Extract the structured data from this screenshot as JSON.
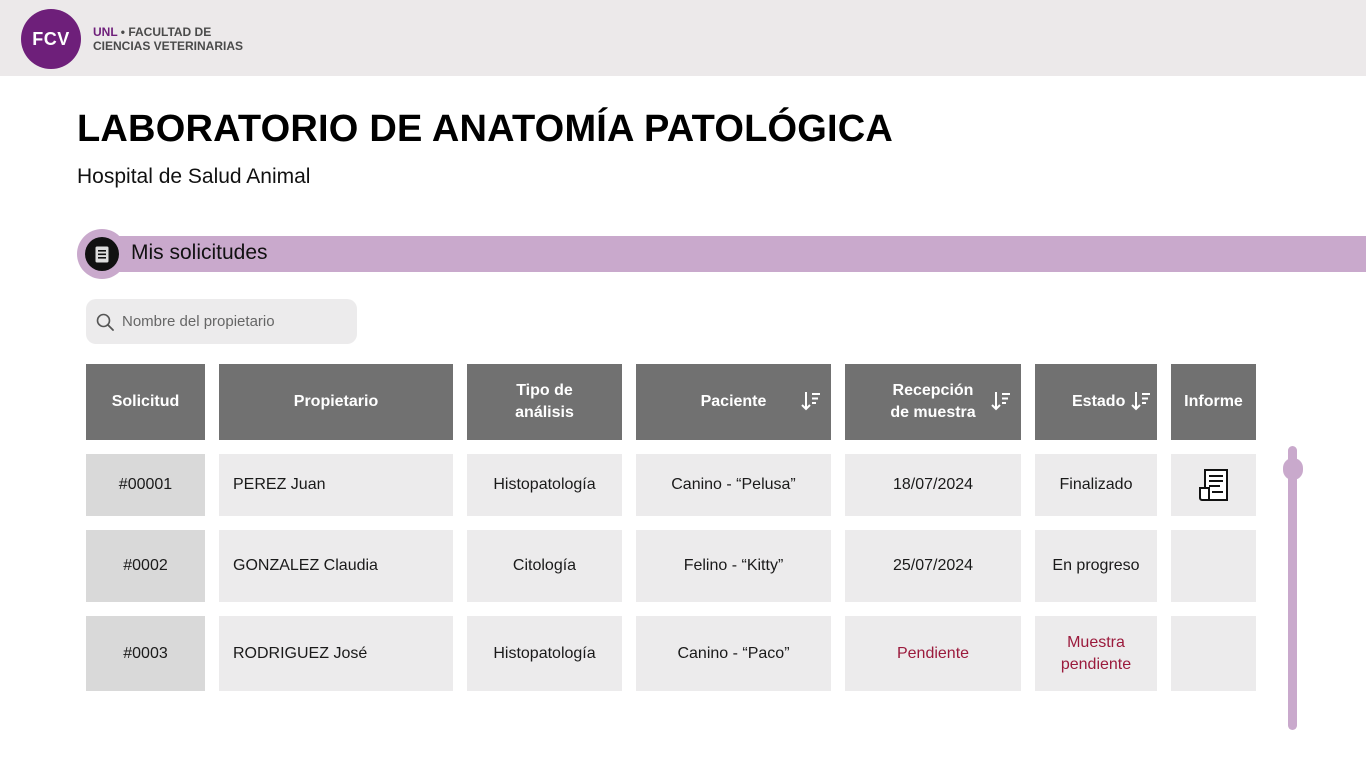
{
  "header": {
    "logo_text": "FCV",
    "org_unl": "UNL",
    "org_line1": "• FACULTAD DE",
    "org_line2": "CIENCIAS VETERINARIAS"
  },
  "page": {
    "title": "LABORATORIO DE ANATOMÍA PATOLÓGICA",
    "subtitle": "Hospital de Salud Animal"
  },
  "section": {
    "title": "Mis solicitudes",
    "icon": "document-list-icon"
  },
  "search": {
    "placeholder": "Nombre del propietario",
    "value": "",
    "icon": "search-icon"
  },
  "table": {
    "columns": {
      "solicitud": "Solicitud",
      "propietario": "Propietario",
      "tipo_line1": "Tipo de",
      "tipo_line2": "análisis",
      "paciente": "Paciente",
      "recepcion_line1": "Recepción",
      "recepcion_line2": "de muestra",
      "estado": "Estado",
      "informe": "Informe"
    },
    "rows": [
      {
        "solicitud": "#00001",
        "propietario": "PEREZ Juan",
        "tipo": "Histopatología",
        "paciente": "Canino - “Pelusa”",
        "recepcion": "18/07/2024",
        "estado_line1": "Finalizado",
        "estado_line2": "",
        "informe": "report-document-icon"
      },
      {
        "solicitud": "#0002",
        "propietario": "GONZALEZ Claudia",
        "tipo": "Citología",
        "paciente": "Felino - “Kitty”",
        "recepcion": "25/07/2024",
        "estado_line1": "En progreso",
        "estado_line2": "",
        "informe": ""
      },
      {
        "solicitud": "#0003",
        "propietario": "RODRIGUEZ José",
        "tipo": "Histopatología",
        "paciente": "Canino - “Paco”",
        "recepcion": "Pendiente",
        "estado_line1": "Muestra",
        "estado_line2": "pendiente",
        "informe": ""
      }
    ]
  },
  "colors": {
    "brand_purple": "#6e1f7a",
    "accent_lilac": "#c9a9cc",
    "header_gray": "#717171",
    "pending_red": "#9b1a3c"
  }
}
